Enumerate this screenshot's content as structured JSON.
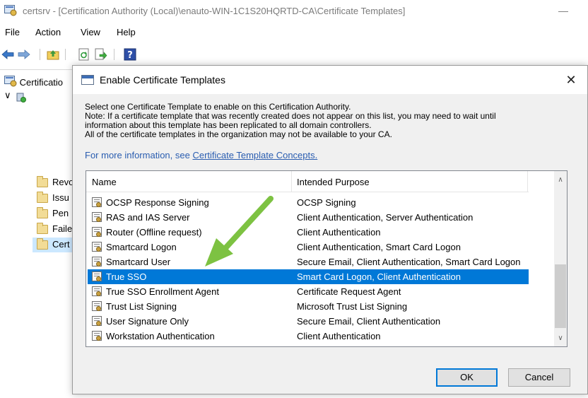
{
  "window": {
    "title": "certsrv - [Certification Authority (Local)\\enauto-WIN-1C1S20HQRTD-CA\\Certificate Templates]",
    "minimize_glyph": "—"
  },
  "menu": [
    "File",
    "Action",
    "View",
    "Help"
  ],
  "toolbar": {
    "icons": [
      "back-arrow-icon",
      "forward-arrow-icon",
      "up-folder-icon",
      "refresh-icon",
      "export-list-icon",
      "help-icon"
    ]
  },
  "tree": {
    "root_label": "Certificatio",
    "expander": "∨",
    "nodes": [
      "Revo",
      "Issu",
      "Pen",
      "Faile",
      "Cert"
    ],
    "selected_index": 4
  },
  "dialog": {
    "title": "Enable Certificate Templates",
    "close_glyph": "✕",
    "description": [
      "Select one Certificate Template to enable on this Certification Authority.",
      "Note: If a certificate template that was recently created does not appear on this list, you may need to wait until",
      "information about this template has been replicated to all domain controllers.",
      "All of the certificate templates in the organization may not be available to your CA."
    ],
    "more_info_prefix": "For more information, see ",
    "more_info_link": "Certificate Template Concepts.",
    "columns": {
      "name": "Name",
      "purpose": "Intended Purpose"
    },
    "rows": [
      {
        "name": "OCSP Response Signing",
        "purpose": "OCSP Signing"
      },
      {
        "name": "RAS and IAS Server",
        "purpose": "Client Authentication, Server Authentication"
      },
      {
        "name": "Router (Offline request)",
        "purpose": "Client Authentication"
      },
      {
        "name": "Smartcard Logon",
        "purpose": "Client Authentication, Smart Card Logon"
      },
      {
        "name": "Smartcard User",
        "purpose": "Secure Email, Client Authentication, Smart Card Logon"
      },
      {
        "name": "True SSO",
        "purpose": "Smart Card Logon, Client Authentication"
      },
      {
        "name": "True SSO Enrollment Agent",
        "purpose": "Certificate Request Agent"
      },
      {
        "name": "Trust List Signing",
        "purpose": "Microsoft Trust List Signing"
      },
      {
        "name": "User Signature Only",
        "purpose": "Secure Email, Client Authentication"
      },
      {
        "name": "Workstation Authentication",
        "purpose": "Client Authentication"
      }
    ],
    "selected_row": "True SSO",
    "scroll_up_glyph": "∧",
    "scroll_down_glyph": "∨",
    "ok_label": "OK",
    "cancel_label": "Cancel"
  },
  "colors": {
    "selection": "#0078d7",
    "link": "#2a5db0",
    "annotation_arrow": "#7dc242"
  }
}
